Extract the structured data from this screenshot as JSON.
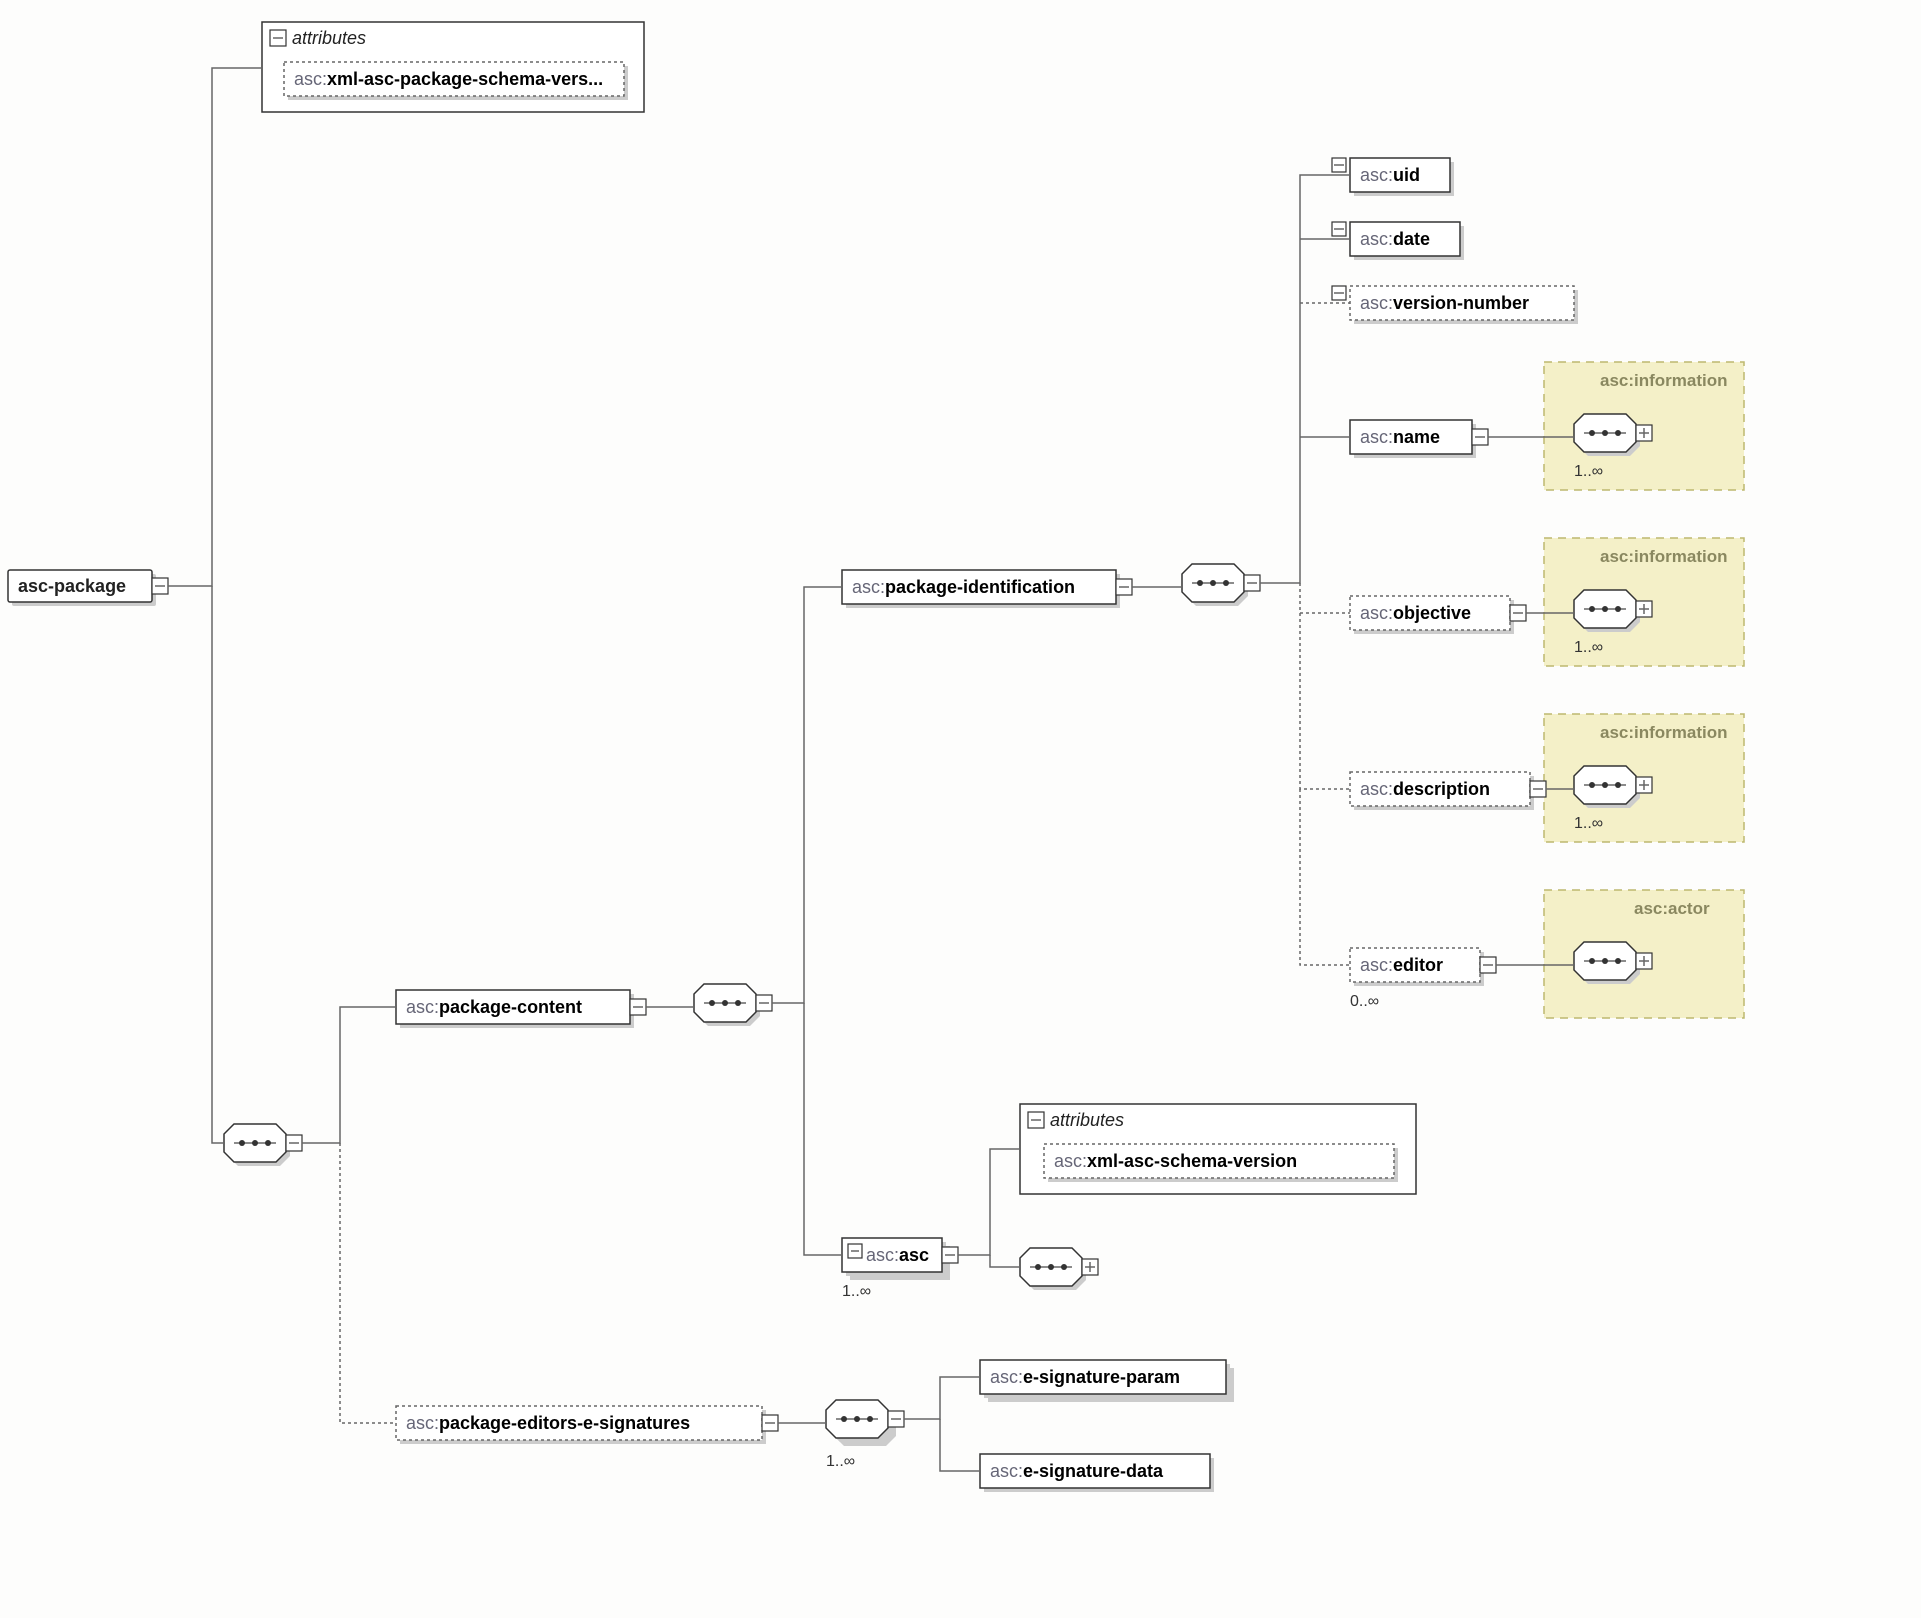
{
  "root": {
    "label": "asc-package"
  },
  "attributes_label": "attributes",
  "schema_version": {
    "prefix": "asc:",
    "name": "xml-asc-package-schema-vers..."
  },
  "package_content": {
    "prefix": "asc:",
    "name": "package-content"
  },
  "package_identification": {
    "prefix": "asc:",
    "name": "package-identification"
  },
  "uid": {
    "prefix": "asc:",
    "name": "uid"
  },
  "date": {
    "prefix": "asc:",
    "name": "date"
  },
  "version_number": {
    "prefix": "asc:",
    "name": "version-number"
  },
  "name_node": {
    "prefix": "asc:",
    "name": "name"
  },
  "objective": {
    "prefix": "asc:",
    "name": "objective"
  },
  "description": {
    "prefix": "asc:",
    "name": "description"
  },
  "editor": {
    "prefix": "asc:",
    "name": "editor"
  },
  "info_title": "asc:information",
  "actor_title": "asc:actor",
  "asc_asc": {
    "prefix": "asc:",
    "name": "asc"
  },
  "asc_schema_version": {
    "prefix": "asc:",
    "name": "xml-asc-schema-version"
  },
  "package_editors": {
    "prefix": "asc:",
    "name": "package-editors-e-signatures"
  },
  "esig_param": {
    "prefix": "asc:",
    "name": "e-signature-param"
  },
  "esig_data": {
    "prefix": "asc:",
    "name": "e-signature-data"
  },
  "card_1inf": "1..∞",
  "card_0inf": "0..∞"
}
